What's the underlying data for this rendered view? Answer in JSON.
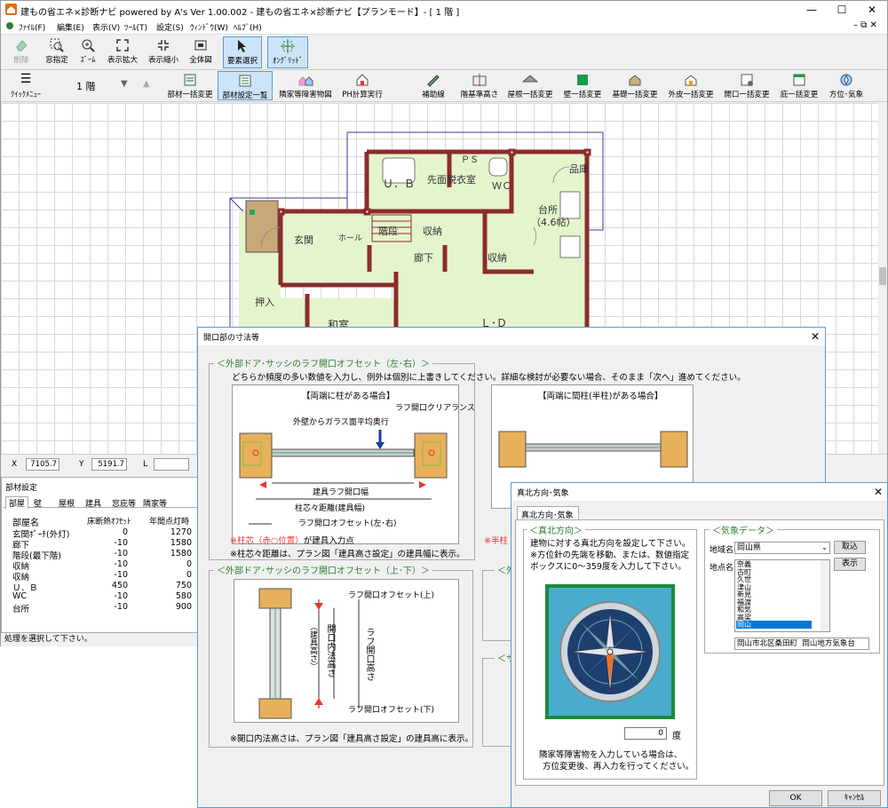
{
  "window": {
    "title": "建もの省エネ×診断ナビ powered by A's Ver 1.00.002 - 建もの省エネ×診断ナビ【プランモード】- [ 1 階 ]"
  },
  "menu": [
    "ﾌｧｲﾙ(F)",
    "編集(E)",
    "表示(V)",
    "ﾂｰﾙ(T)",
    "設定(S)",
    "ｳｨﾝﾄﾞｳ(W)",
    "ﾍﾙﾌﾟ(H)"
  ],
  "toolbar1": [
    "削除",
    "窓指定",
    "ｽﾞｰﾑ",
    "表示拡大",
    "表示縮小",
    "全体図",
    "要素選択",
    "ｵﾝｸﾞﾘｯﾄﾞ"
  ],
  "toolbar2": {
    "quick_menu": "ｸｲｯｸﾒﾆｭｰ",
    "floor": "1 階",
    "buttons": [
      "部材一括変更",
      "部材設定一覧",
      "隣家等障害物図",
      "PH計算実行",
      "補助線",
      "階基準高さ",
      "屋根一括変更",
      "壁一括変更",
      "基礎一括変更",
      "外皮一括変更",
      "開口一括変更",
      "庇一括変更",
      "方位･気象"
    ]
  },
  "plan_labels": [
    "Ｕ．Ｂ",
    "先面脱衣室",
    "ＷＣ",
    "ＰＳ",
    "品庫",
    "台所",
    "（4.6帖）",
    "玄関",
    "ホール",
    "階段",
    "収納",
    "廊下",
    "収納",
    "押入",
    "和室",
    "Ｌ･Ｄ"
  ],
  "coords": {
    "x_label": "X",
    "x": "7105.7",
    "y_label": "Y",
    "y": "5191.7",
    "l_label": "L",
    "l": ""
  },
  "panel": {
    "title": "部材設定",
    "tabs": [
      "部屋",
      "壁",
      "屋根",
      "建具",
      "窓庇等",
      "隣家等"
    ],
    "headers": [
      "部屋名",
      "床断熱ｵﾌｾｯﾄ",
      "年間点灯時"
    ],
    "rows": [
      [
        "玄関ﾎﾟｰﾁ(外灯)",
        "0",
        "1270"
      ],
      [
        "廊下",
        "-10",
        "1580"
      ],
      [
        "階段(最下階)",
        "-10",
        "1580"
      ],
      [
        "収納",
        "-10",
        "0"
      ],
      [
        "収納",
        "-10",
        "0"
      ],
      [
        "Ｕ．Ｂ",
        "450",
        "750"
      ],
      [
        "WC",
        "-10",
        "580"
      ],
      [
        "台所",
        "-10",
        "900"
      ]
    ]
  },
  "status": "処理を選択して下さい。",
  "dialog1": {
    "title": "開口部の寸法等",
    "group1_title": "＜外部ドア･サッシのラフ開口オフセット（左･右）＞",
    "intro": "どちらか頻度の多い数値を入力し、例外は個別に上書きしてください。詳細な検討が必要ない場合、そのまま「次へ」進めてください。",
    "case1_title": "【両端に柱がある場合】",
    "case2_title": "【両端に間柱(半柱)がある場合】",
    "lbl_clear": "ラフ開口クリアランス",
    "lbl_glass": "外壁からガラス面平均奥行",
    "lbl_width": "建具ラフ開口幅",
    "lbl_span": "柱芯々距離(建具幅)",
    "lbl_offset_lr": "ラフ開口オフセット(左･右)",
    "note1_red": "※柱芯（赤○位置）",
    "note1_black": "が建具入力点",
    "note2": "※柱芯々距離は、プラン図「建具高さ設定」の建具幅に表示。",
    "note_half": "※半柱",
    "group2_title": "＜外部ドア･サッシのラフ開口オフセット（上･下）＞",
    "lbl_top": "ラフ開口オフセット(上)",
    "lbl_bottom": "ラフ開口オフセット(下)",
    "lbl_inner": "開口内法高さ",
    "lbl_inner_sub": "（建具高さ）",
    "lbl_rough_h": "ラフ開口高さ",
    "note3": "※開口内法高さは、プラン図「建具高さ設定」の建具高に表示。",
    "group3_title": "＜外",
    "group4_title": "＜サ"
  },
  "dialog2": {
    "title": "真北方向･気象",
    "tab": "真北方向･気象",
    "north_group": "＜真北方向＞",
    "north_desc": [
      "建物に対する真北方向を設定して下さい。",
      "※方位針の先端を移動、または、数値指定",
      "ボックスに0～359度を入力して下さい。"
    ],
    "angle": "0",
    "angle_unit": "度",
    "north_note": [
      "隣家等障害物を入力している場合は、",
      "方位変更後、再入力を行ってください。"
    ],
    "weather_group": "＜気象データ＞",
    "region_label": "地域名",
    "region_value": "岡山県",
    "cancel_btn": "取込",
    "point_label": "地点名",
    "show_btn": "表示",
    "points": [
      "奈義",
      "古町",
      "久世",
      "津山",
      "新見",
      "福渡",
      "和気",
      "高梁",
      "岡山"
    ],
    "selected_point": "岡山",
    "station_field1": "岡山市北区桑田町",
    "station_field2": "岡山地方気象台",
    "ok": "OK",
    "cancel": "ｷｬﾝｾﾙ"
  }
}
